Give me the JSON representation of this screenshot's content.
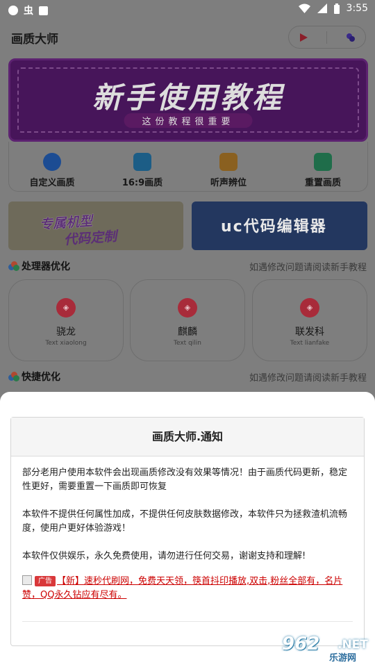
{
  "status_bar": {
    "time": "3:55",
    "carrier_icon": "bug-icon"
  },
  "app": {
    "title": "画质大师"
  },
  "top_buttons": [
    {
      "name": "play-icon"
    },
    {
      "name": "puzzle-icon"
    }
  ],
  "banner": {
    "title": "新手使用教程",
    "subtitle": "这份教程很重要"
  },
  "quick_actions": [
    {
      "label": "自定义画质",
      "color": "#1c4c93"
    },
    {
      "label": "16:9画质",
      "color": "#1c5d86"
    },
    {
      "label": "听声辨位",
      "color": "#8a6020"
    },
    {
      "label": "重置画质",
      "color": "#1f6d4a"
    }
  ],
  "ads": {
    "left_line1": "专属机型",
    "left_line2": "代码定制",
    "right_title": "uc代码编辑器"
  },
  "sections": [
    {
      "title": "处理器优化",
      "hint": "如遇修改问题请阅读新手教程"
    },
    {
      "title": "快捷优化",
      "hint": "如遇修改问题请阅读新手教程"
    }
  ],
  "processors": [
    {
      "name": "骁龙",
      "en": "Text xiaolong"
    },
    {
      "name": "麒麟",
      "en": "Text qilin"
    },
    {
      "name": "联发科",
      "en": "Text lianfake"
    }
  ],
  "dialog": {
    "title": "画质大师.通知",
    "p1": "部分老用户使用本软件会出现画质修改没有效果等情况！由于画质代码更新，稳定性更好，需要重置一下画质即可恢复",
    "p2": "本软件不提供任何属性加成，不提供任何皮肤数据修改，本软件只为拯救渣机流畅度，使用户更好体验游戏！",
    "p3": "本软件仅供娱乐，永久免费使用，请勿进行任何交易，谢谢支持和理解!",
    "ad_tag": "广告",
    "ad_text": "【新】速秒代刷网，免费天天领，筷首抖印播放,双击,粉丝全部有，名片赞，QQ永久钻应有尽有。"
  },
  "watermark": {
    "num": "962",
    "net": ".NET",
    "cn": "乐游网"
  }
}
